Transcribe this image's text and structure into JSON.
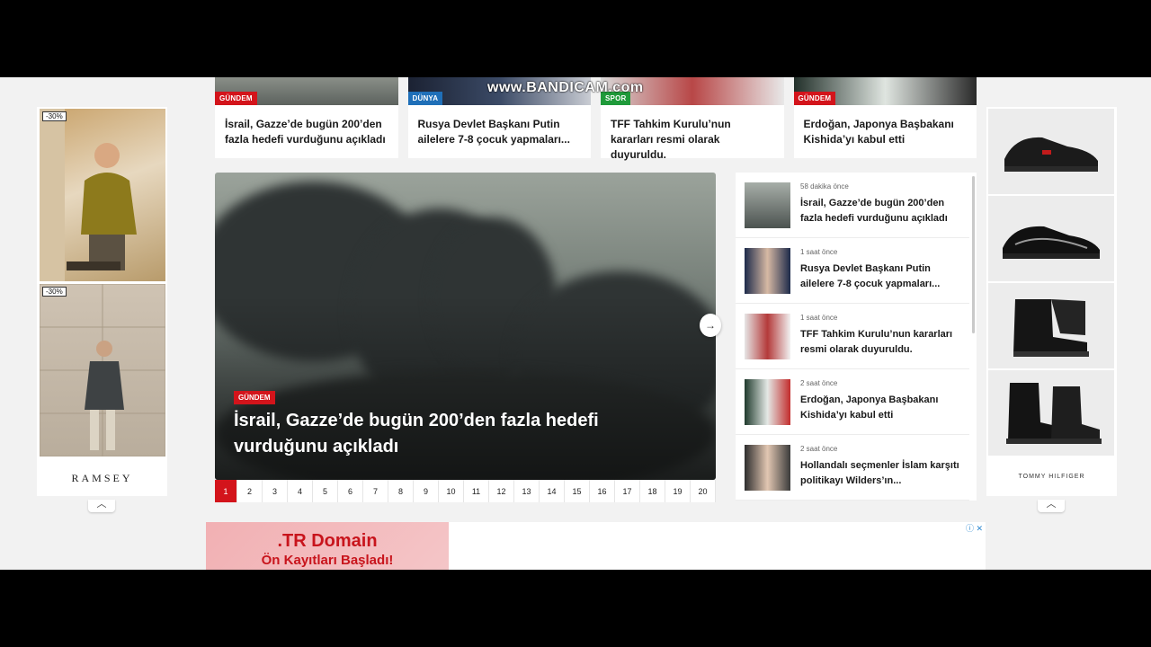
{
  "watermark": "www.BANDICAM.com",
  "top_cards": [
    {
      "badge": "GÜNDEM",
      "badge_color": "#d3141b",
      "title": "İsrail, Gazze’de bugün 200’den fazla hedefi vurduğunu açıkladı"
    },
    {
      "badge": "DÜNYA",
      "badge_color": "#1f6fb8",
      "title": "Rusya Devlet Başkanı Putin ailelere 7-8 çocuk yapmaları..."
    },
    {
      "badge": "SPOR",
      "badge_color": "#1f9a3a",
      "title": "TFF Tahkim Kurulu’nun kararları resmi olarak duyuruldu."
    },
    {
      "badge": "GÜNDEM",
      "badge_color": "#d3141b",
      "title": "Erdoğan, Japonya Başbakanı Kishida’yı kabul etti"
    }
  ],
  "slider": {
    "badge": "GÜNDEM",
    "headline": "İsrail, Gazze’de bugün 200’den fazla hedefi vurduğunu açıkladı",
    "next_icon": "→",
    "pages": [
      "1",
      "2",
      "3",
      "4",
      "5",
      "6",
      "7",
      "8",
      "9",
      "10",
      "11",
      "12",
      "13",
      "14",
      "15",
      "16",
      "17",
      "18",
      "19",
      "20"
    ],
    "active_page": "1"
  },
  "side_list": [
    {
      "time": "58 dakika önce",
      "title": "İsrail, Gazze’de bugün 200’den fazla hedefi vurduğunu açıkladı"
    },
    {
      "time": "1 saat önce",
      "title": "Rusya Devlet Başkanı Putin ailelere 7-8 çocuk yapmaları..."
    },
    {
      "time": "1 saat önce",
      "title": "TFF Tahkim Kurulu’nun kararları resmi olarak duyuruldu."
    },
    {
      "time": "2 saat önce",
      "title": "Erdoğan, Japonya Başbakanı Kishida’yı kabul etti"
    },
    {
      "time": "2 saat önce",
      "title": "Hollandalı seçmenler İslam karşıtı politikayı Wilders’ın..."
    }
  ],
  "ad_left": {
    "discount_1": "-30%",
    "discount_2": "-30%",
    "brand": "RAMSEY",
    "adchoice": "ⓘ ✕",
    "collapse": "︿"
  },
  "ad_right": {
    "brand": "TOMMY HILFIGER",
    "adchoice": "ⓘ ✕",
    "collapse": "︿"
  },
  "banner": {
    "line1": ".TR Domain",
    "line2": "Ön Kayıtları Başladı!",
    "adchoice": "ⓘ ✕"
  }
}
